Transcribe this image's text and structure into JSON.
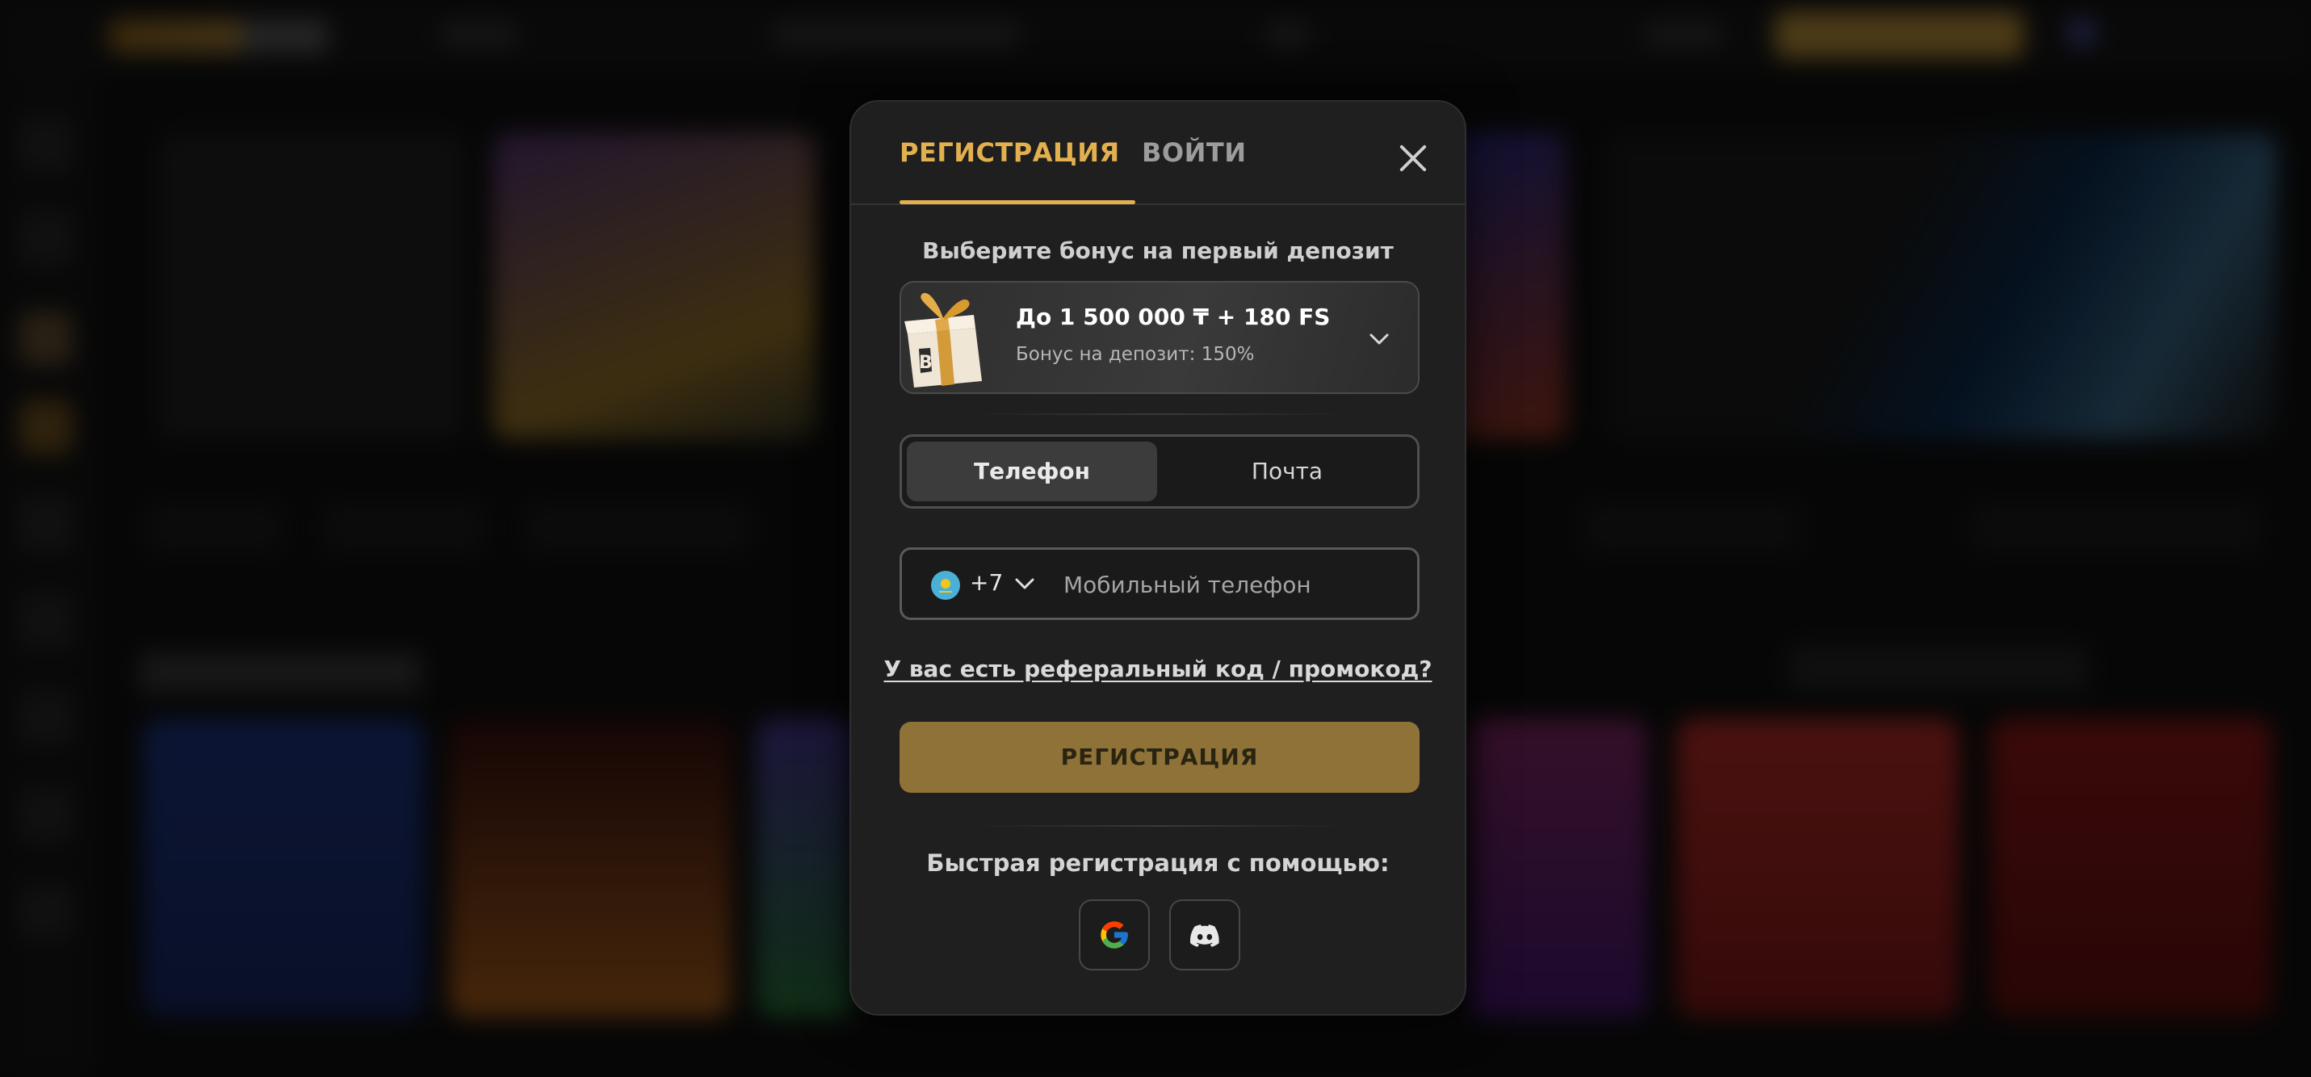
{
  "tabs": {
    "register": "РЕГИСТРАЦИЯ",
    "login": "ВОЙТИ"
  },
  "bonus": {
    "title": "Выберите бонус на первый депозит",
    "amount": "До 1 500 000 ₸ + 180 FS",
    "subtitle": "Бонус на депозит: 150%"
  },
  "method": {
    "phone": "Телефон",
    "email": "Почта",
    "selected": "Телефон"
  },
  "phone_field": {
    "country_code": "+7",
    "placeholder": "Мобильный телефон",
    "value": ""
  },
  "promo_link": "У вас есть реферальный код / промокод?",
  "submit_label": "РЕГИСТРАЦИЯ",
  "quick_register": "Быстрая регистрация с помощью:",
  "social_providers": [
    "google-icon",
    "discord-icon"
  ],
  "colors": {
    "accent": "#e3b04f",
    "submit": "#8f7238",
    "modal_bg": "#1f1f1f"
  }
}
